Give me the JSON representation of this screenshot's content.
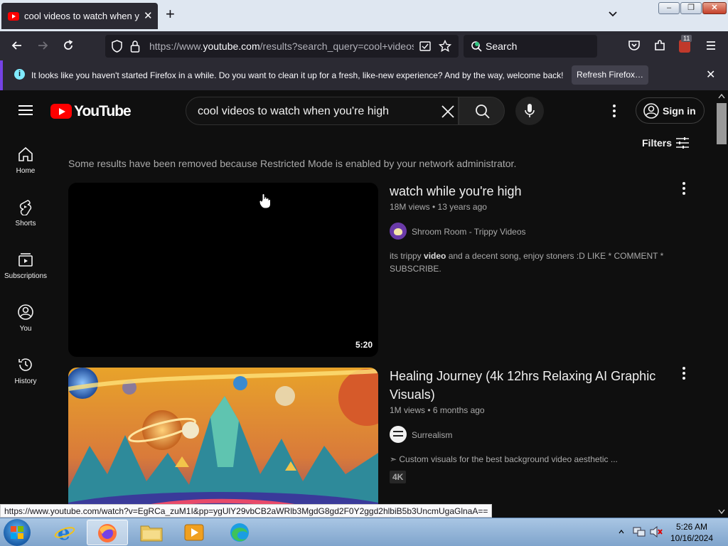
{
  "browser": {
    "tab": {
      "title": "cool videos to watch when you're high"
    },
    "url": {
      "prefix": "https://www.",
      "domain": "youtube.com",
      "path": "/results?search_query=cool+videos+to+watch"
    },
    "search_placeholder": "Search",
    "extension_badge": "11",
    "notification": {
      "message": "It looks like you haven't started Firefox in a while. Do you want to clean it up for a fresh, like-new experience? And by the way, welcome back!",
      "button": "Refresh Firefox…"
    },
    "status_url": "https://www.youtube.com/watch?v=EgRCa_zuM1I&pp=ygUlY29vbCB2aWRlb3MgdG8gd2F0Y2ggd2hlbiB5b3UncmUgaGlnaA=="
  },
  "youtube": {
    "logo_text": "YouTube",
    "search_query": "cool videos to watch when you're high",
    "sign_in": "Sign in",
    "filters": "Filters",
    "sidebar": [
      {
        "label": "Home",
        "icon": "home-icon"
      },
      {
        "label": "Shorts",
        "icon": "shorts-icon"
      },
      {
        "label": "Subscriptions",
        "icon": "subscriptions-icon"
      },
      {
        "label": "You",
        "icon": "you-icon"
      },
      {
        "label": "History",
        "icon": "history-icon"
      }
    ],
    "restricted_notice": "Some results have been removed because Restricted Mode is enabled by your network administrator.",
    "results": [
      {
        "title": "watch while you're high",
        "meta": "18M views • 13 years ago",
        "channel": "Shroom Room - Trippy Videos",
        "description": "its trippy video and a decent song, enjoy stoners :D LIKE * COMMENT * SUBSCRIBE.",
        "description_bold": "video",
        "duration": "5:20"
      },
      {
        "title": "Healing Journey (4k 12hrs Relaxing AI Graphic Visuals)",
        "meta": "1M views • 6 months ago",
        "channel": "Surrealism",
        "description": "➣ Custom visuals for the best background video aesthetic ...",
        "tag": "4K"
      }
    ]
  },
  "taskbar": {
    "time": "5:26 AM",
    "date": "10/16/2024",
    "apps": [
      "internet-explorer",
      "firefox",
      "file-explorer",
      "media-player",
      "edge"
    ]
  },
  "colors": {
    "youtube_red": "#ff0000",
    "yt_bg": "#0f0f0f",
    "firefox_dark": "#2b2a33"
  }
}
